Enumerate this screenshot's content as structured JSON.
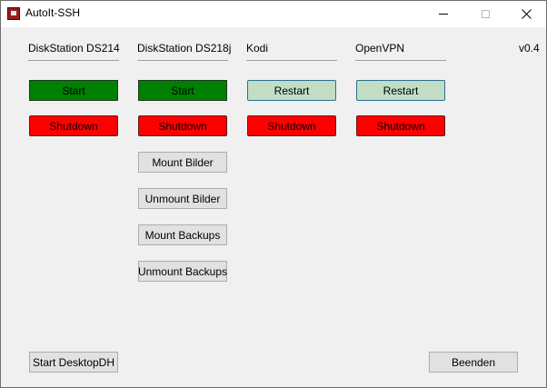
{
  "window": {
    "title": "AutoIt-SSH",
    "version": "v0.4"
  },
  "columns": [
    {
      "header": "DiskStation DS214",
      "primary_label": "Start",
      "shutdown_label": "Shutdown"
    },
    {
      "header": "DiskStation DS218j",
      "primary_label": "Start",
      "shutdown_label": "Shutdown",
      "extra_buttons": [
        "Mount Bilder",
        "Unmount Bilder",
        "Mount Backups",
        "Unmount Backups"
      ]
    },
    {
      "header": "Kodi",
      "primary_label": "Restart",
      "shutdown_label": "Shutdown"
    },
    {
      "header": "OpenVPN",
      "primary_label": "Restart",
      "shutdown_label": "Shutdown"
    }
  ],
  "footer": {
    "start_desktop_label": "Start DesktopDH",
    "exit_label": "Beenden"
  },
  "colors": {
    "start": "#008000",
    "restart": "#c1dec5",
    "shutdown": "#ff0000",
    "standard": "#e1e1e1"
  }
}
